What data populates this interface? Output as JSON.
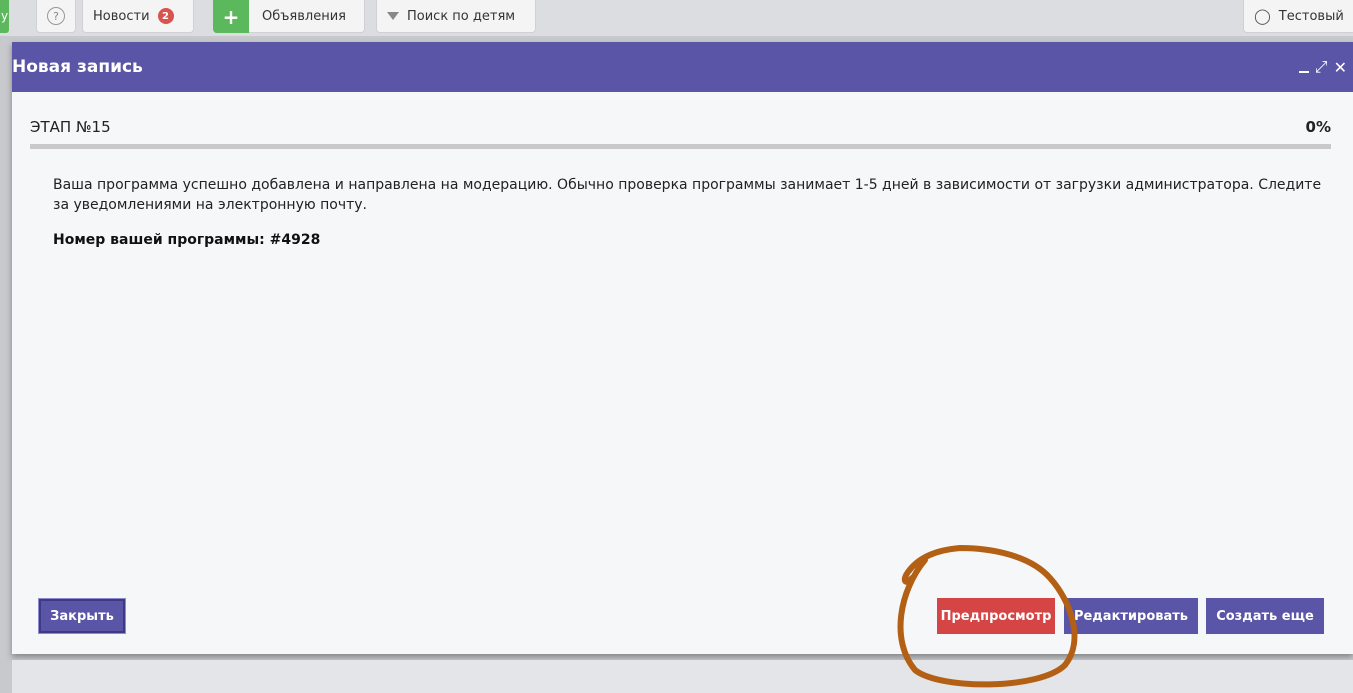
{
  "topbar": {
    "edge_label": "у",
    "help_label": "?",
    "news_label": "Новости",
    "news_badge": "2",
    "add_label": "+",
    "ads_label": "Объявления",
    "search_children_label": "Поиск по детям",
    "user_label": "Тестовый"
  },
  "modal": {
    "title": "Новая запись",
    "stage_label": "ЭТАП №15",
    "progress_percent": "0%",
    "progress_value": 0,
    "message": "Ваша программа успешно добавлена и направлена на модерацию. Обычно проверка программы занимает 1-5 дней в зависимости от загрузки администратора. Следите за уведомлениями на электронную почту.",
    "program_number": "Номер вашей программы: #4928",
    "buttons": {
      "close": "Закрыть",
      "preview": "Предпросмотр",
      "edit": "Редактировать",
      "create_more": "Создать еще"
    }
  },
  "colors": {
    "header": "#5a55a6",
    "primary_button": "#5a55a6",
    "danger_button": "#d64545",
    "annotation": "#b35f14"
  },
  "icons": {
    "minimize": "minimize-icon",
    "expand": "expand-icon",
    "close": "close-icon",
    "user": "user-icon",
    "filter": "filter-icon",
    "help": "help-icon"
  }
}
